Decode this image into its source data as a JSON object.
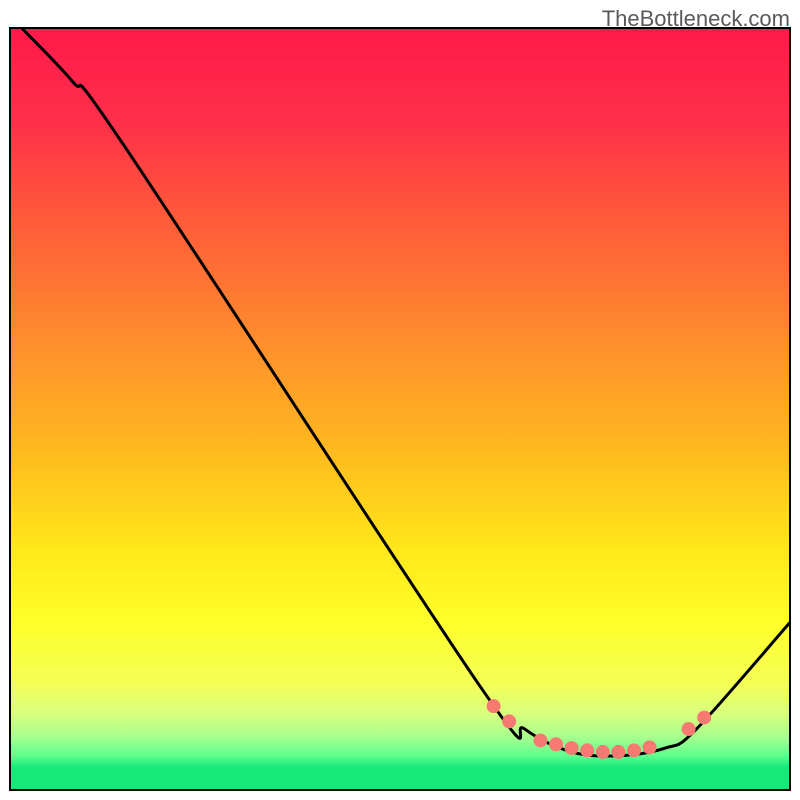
{
  "watermark": "TheBottleneck.com",
  "chart_data": {
    "type": "line",
    "xlim": [
      0,
      100
    ],
    "ylim": [
      0,
      100
    ],
    "title": "",
    "xlabel": "",
    "ylabel": "",
    "curve": [
      {
        "x": 1.5,
        "y": 100
      },
      {
        "x": 8,
        "y": 93
      },
      {
        "x": 15,
        "y": 84
      },
      {
        "x": 60,
        "y": 14
      },
      {
        "x": 66,
        "y": 8
      },
      {
        "x": 72,
        "y": 5
      },
      {
        "x": 78,
        "y": 4.5
      },
      {
        "x": 84,
        "y": 5.5
      },
      {
        "x": 88,
        "y": 8
      },
      {
        "x": 100,
        "y": 22
      }
    ],
    "markers": [
      {
        "x": 62,
        "y": 11
      },
      {
        "x": 64,
        "y": 9
      },
      {
        "x": 68,
        "y": 6.5
      },
      {
        "x": 70,
        "y": 6
      },
      {
        "x": 72,
        "y": 5.5
      },
      {
        "x": 74,
        "y": 5.2
      },
      {
        "x": 76,
        "y": 5
      },
      {
        "x": 78,
        "y": 5
      },
      {
        "x": 80,
        "y": 5.2
      },
      {
        "x": 82,
        "y": 5.6
      },
      {
        "x": 87,
        "y": 8
      },
      {
        "x": 89,
        "y": 9.5
      }
    ],
    "gradient_bands": {
      "description": "Vertical color gradient from red (top) through orange/yellow to green (bottom), with green concentrated in bottom ~8%"
    },
    "border": true
  }
}
